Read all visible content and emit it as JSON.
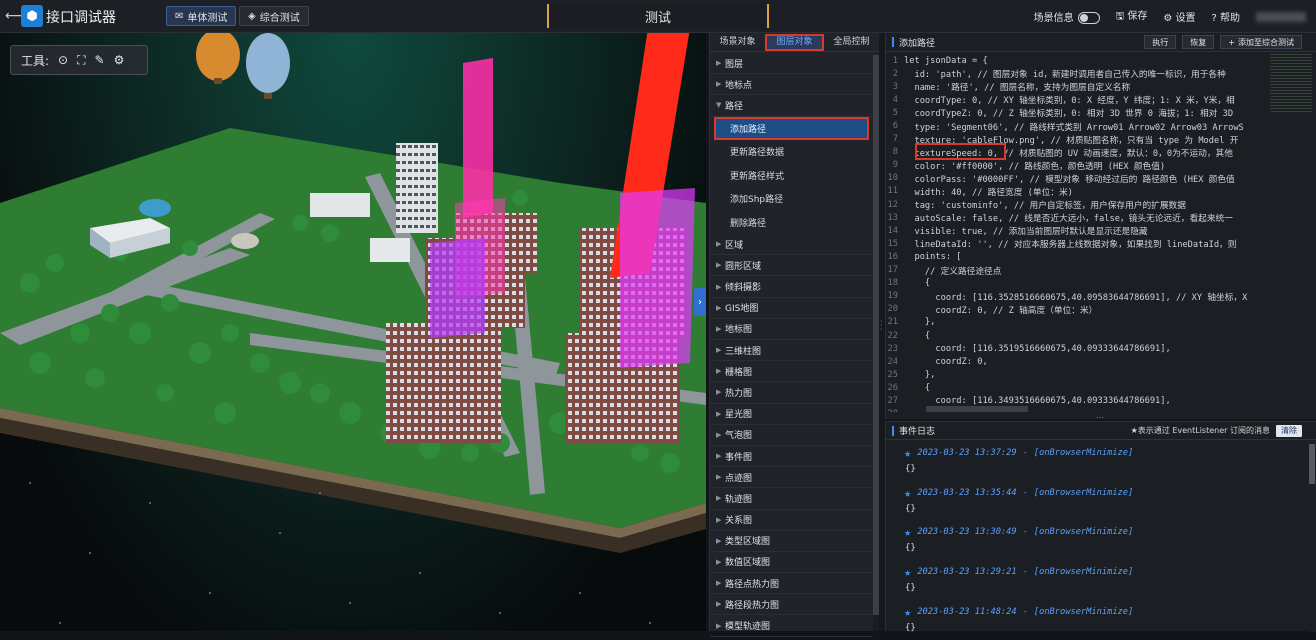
{
  "app": {
    "title": "接口调试器",
    "back_icon": "arrow-left-icon",
    "logo_icon": "cube-logo-icon"
  },
  "modes": [
    {
      "label": "单体测试",
      "icon": "mail-icon",
      "active": true
    },
    {
      "label": "综合测试",
      "icon": "layers-icon",
      "active": false
    }
  ],
  "scene_title": "测试",
  "top_right": {
    "scene_info": "场景信息",
    "save": "保存",
    "settings": "设置",
    "help": "帮助"
  },
  "viewport": {
    "tool_label": "工具:"
  },
  "category_panel": {
    "tabs": [
      {
        "label": "场景对象",
        "active": false
      },
      {
        "label": "图层对象",
        "active": true
      },
      {
        "label": "全局控制",
        "active": false
      }
    ],
    "items_before": [
      "图层",
      "地标点"
    ],
    "expanded": {
      "label": "路径",
      "children": [
        {
          "label": "添加路径",
          "active": true
        },
        {
          "label": "更新路径数据",
          "active": false
        },
        {
          "label": "更新路径样式",
          "active": false
        },
        {
          "label": "添加Shp路径",
          "active": false
        },
        {
          "label": "删除路径",
          "active": false
        }
      ]
    },
    "items_after": [
      "区域",
      "圆形区域",
      "倾斜摄影",
      "GIS地图",
      "地标图",
      "三维柱图",
      "栅格图",
      "热力图",
      "星光图",
      "气泡图",
      "事件图",
      "点迹图",
      "轨迹图",
      "关系图",
      "类型区域图",
      "数值区域图",
      "路径点热力图",
      "路径段热力图",
      "模型轨迹图"
    ]
  },
  "code_panel": {
    "title": "添加路径",
    "buttons": [
      "执行",
      "恢复",
      "添加至综合测试"
    ],
    "lines": [
      "let jsonData = {",
      "  id: 'path', // 图层对象 id，新建时调用者自己传入的唯一标识，用于各种",
      "  name: '路径', // 图层名称，支持为图层自定义名称",
      "  coordType: 0, // XY 轴坐标类别，0: X 经度，Y 纬度；1: X 米，Y米，相",
      "  coordTypeZ: 0, // Z 轴坐标类别，0: 相对 3D 世界 0 海拔；1: 相对 3D",
      "  type: 'Segment06', // 路线样式类别 Arrow01 Arrow02 Arrow03 ArrowS",
      "  texture: 'cableFlow.png', // 材质贴图名称，只有当 type 为 Model 开",
      "  textureSpeed: 0, // 材质贴图的 UV 动画速度，默认：0，0为不运动，其他",
      "  color: '#ff0000', // 路线颜色，颜色透明 (HEX 颜色值)",
      "  colorPass: '#0000FF', // 模型对象 移动经过后的 路径颜色 (HEX 颜色值",
      "  width: 40, // 路径宽度 (单位：米)",
      "  tag: 'custominfo', // 用户自定标签，用户保存用户的扩展数据",
      "  autoScale: false, // 线是否近大远小，false，镜头无论远近，看起来统一",
      "  visible: true, // 添加当前图层时默认是显示还是隐藏",
      "  lineDataId: '', // 对应本服务器上线数据对象，如果找到 lineDataId，则",
      "  points: [",
      "    // 定义路径途径点",
      "    {",
      "      coord: [116.3528516660675,40.09583644786691], // XY 轴坐标，X",
      "      coordZ: 0, // Z 轴高度（单位：米）",
      "    },",
      "    {",
      "      coord: [116.3519516660675,40.09333644786691],",
      "      coordZ: 0,",
      "    },",
      "    {",
      "      coord: [116.3493516660675,40.09333644786691],",
      "      coordZ: 0,"
    ],
    "more_indicator": "..."
  },
  "event_log": {
    "title": "事件日志",
    "hint": "★表示通过 EventListener 订阅的消息",
    "clear_label": "清除",
    "entries": [
      {
        "time": "2023-03-23 13:37:29",
        "event": "[onBrowserMinimize]",
        "body": "{}"
      },
      {
        "time": "2023-03-23 13:35:44",
        "event": "[onBrowserMinimize]",
        "body": "{}"
      },
      {
        "time": "2023-03-23 13:30:49",
        "event": "[onBrowserMinimize]",
        "body": "{}"
      },
      {
        "time": "2023-03-23 13:29:21",
        "event": "[onBrowserMinimize]",
        "body": "{}"
      },
      {
        "time": "2023-03-23 11:48:24",
        "event": "[onBrowserMinimize]",
        "body": "{}"
      }
    ]
  },
  "colors": {
    "accent": "#3c8df0",
    "highlight": "#d8392b",
    "path_red": "#ff2a1a",
    "path_magenta": "#ff2fa8",
    "path_purple": "#b63cff"
  }
}
